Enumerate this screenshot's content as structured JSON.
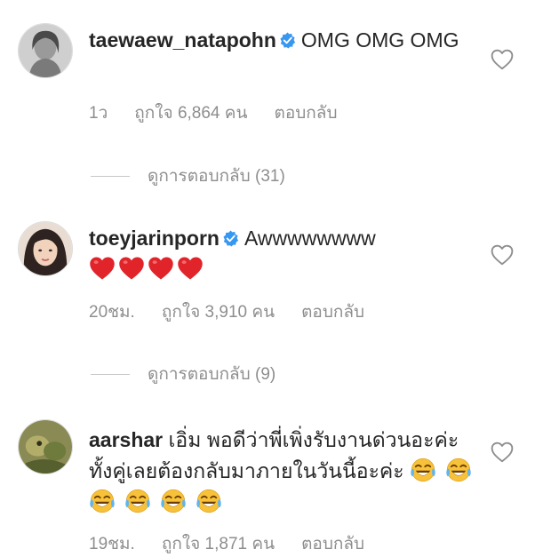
{
  "comments": [
    {
      "username": "taewaew_natapohn",
      "text": "OMG OMG OMG",
      "time": "1ว",
      "likes": "ถูกใจ 6,864 คน",
      "reply": "ตอบกลับ",
      "view_replies": "ดูการตอบกลับ (31)",
      "verified": true
    },
    {
      "username": "toeyjarinporn",
      "text": "Awwwwwwww",
      "emoji": "red-heart x4",
      "time": "20ชม.",
      "likes": "ถูกใจ 3,910 คน",
      "reply": "ตอบกลับ",
      "view_replies": "ดูการตอบกลับ (9)",
      "verified": true
    },
    {
      "username": "aarshar",
      "text": "เอิ่ม พอดีว่าพี่เพิ่งรับงานด่วนอะค่ะ ทั้งคู่เลยต้องกลับมาภายในวันนี้อะค่ะ",
      "emoji": "tears-of-joy x6",
      "time": "19ชม.",
      "likes": "ถูกใจ 1,871 คน",
      "reply": "ตอบกลับ",
      "verified": false
    }
  ],
  "colors": {
    "text": "#262626",
    "meta": "#8e8e8e",
    "verified": "#3897f0",
    "heart": "#e0242a",
    "emoji": "#f7c23a"
  }
}
